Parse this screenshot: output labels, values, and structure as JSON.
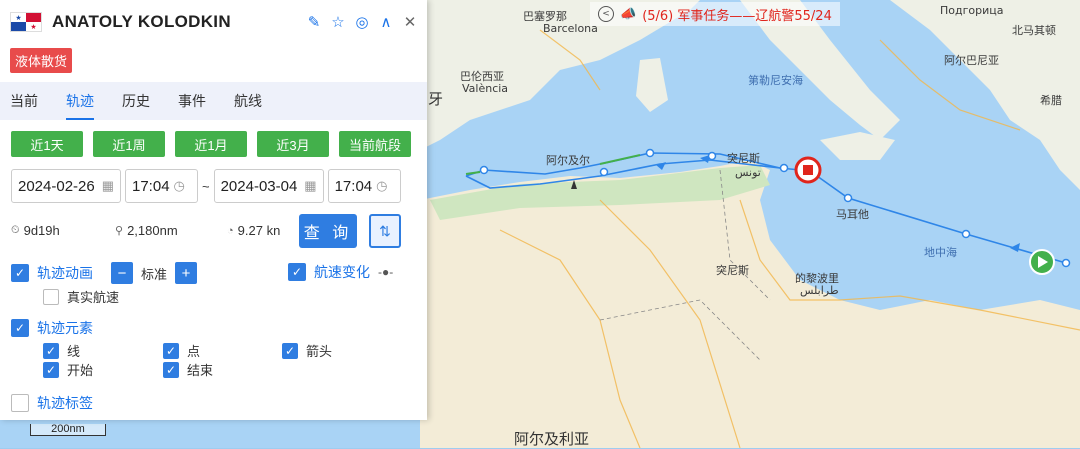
{
  "vessel": {
    "name": "ANATOLY KOLODKIN",
    "cargo_type": "液体散货"
  },
  "header_icons": [
    "edit-icon",
    "star-icon",
    "locate-icon",
    "collapse-icon",
    "close-icon"
  ],
  "tabs": [
    "当前",
    "轨迹",
    "历史",
    "事件",
    "航线"
  ],
  "active_tab": "轨迹",
  "quick_ranges": [
    "近1天",
    "近1周",
    "近1月",
    "近3月",
    "当前航段"
  ],
  "date_range": {
    "start_date": "2024-02-26",
    "start_time": "17:04",
    "separator": "~",
    "end_date": "2024-03-04",
    "end_time": "17:04"
  },
  "stats": {
    "duration": "9d19h",
    "distance": "2,180nm",
    "avg_speed": "9.27 kn"
  },
  "query_label": "查 询",
  "options": {
    "track_animation": "轨迹动画",
    "speed_mode": "标准",
    "real_speed": "真实航速",
    "speed_change": "航速变化",
    "track_elements": "轨迹元素",
    "elements": [
      "线",
      "点",
      "箭头",
      "开始",
      "结束"
    ],
    "track_labels": "轨迹标签"
  },
  "notice": {
    "text": "(5/6) 军事任务——辽航警55/24"
  },
  "map_labels": {
    "barcelona": "Barcelona",
    "barcelona_cn": "巴塞罗那",
    "valencia_cn": "巴伦西亚",
    "valencia": "València",
    "algiers": "阿尔及尔",
    "tunis": "突尼斯",
    "tunis_ar": "تونس",
    "tunisia": "突尼斯",
    "tripoli": "的黎波里",
    "tripoli_ar": "طرابلس",
    "algeria": "阿尔及利亚",
    "mediterranean": "地中海",
    "malta": "马耳他",
    "tyrrhenian": "第勒尼安海",
    "albania": "阿尔巴尼亚",
    "greece": "希腊",
    "north_macedonia": "北马其顿",
    "podgorica": "Подгорица",
    "spain_frag": "牙",
    "scale": "200nm"
  },
  "colors": {
    "track": "#2f86e8",
    "accent": "#1a73e8",
    "green": "#43b04b",
    "badge_red": "#e84b4b",
    "notice_red": "#e0251c"
  }
}
